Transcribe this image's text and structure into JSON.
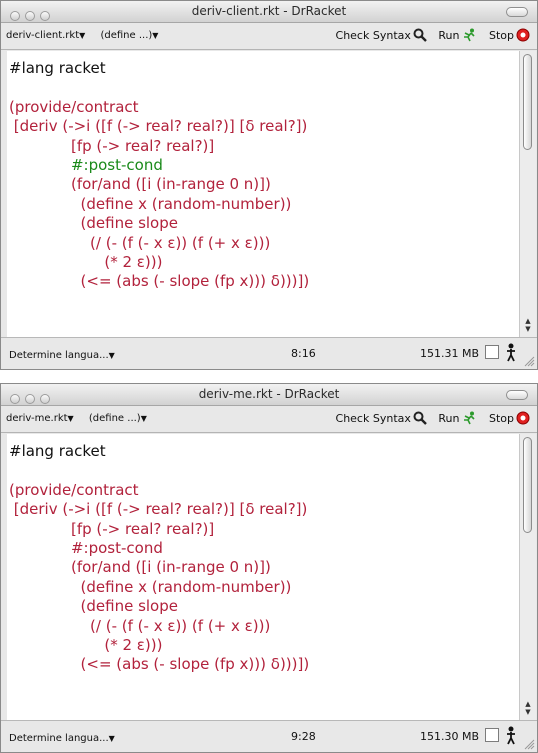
{
  "windows": [
    {
      "title": "deriv-client.rkt - DrRacket",
      "file_menu": "deriv-client.rkt",
      "define_menu": "(define ...)",
      "check_syntax": "Check Syntax",
      "run": "Run",
      "stop": "Stop",
      "code": [
        "#lang racket",
        "",
        "(provide/contract",
        " [deriv (->i ([f (-> real? real?)] [δ real?])",
        "             [fp (-> real? real?)]",
        "             #:post-cond",
        "             (for/and ([i (in-range 0 n)])",
        "               (define x (random-number))",
        "               (define slope",
        "                 (/ (- (f (- x ε)) (f (+ x ε)))",
        "                    (* 2 ε)))",
        "               (<= (abs (- slope (fp x))) δ)))])"
      ],
      "language": "Determine langua...",
      "position": "8:16",
      "memory": "151.31 MB"
    },
    {
      "title": "deriv-me.rkt - DrRacket",
      "file_menu": "deriv-me.rkt",
      "define_menu": "(define ...)",
      "check_syntax": "Check Syntax",
      "run": "Run",
      "stop": "Stop",
      "code": [
        "#lang racket",
        "",
        "(provide/contract",
        " [deriv (->i ([f (-> real? real?)] [δ real?])",
        "             [fp (-> real? real?)]",
        "             #:post-cond",
        "             (for/and ([i (in-range 0 n)])",
        "               (define x (random-number))",
        "               (define slope",
        "                 (/ (- (f (- x ε)) (f (+ x ε)))",
        "                    (* 2 ε)))",
        "               (<= (abs (- slope (fp x))) δ)))])"
      ],
      "language": "Determine langua...",
      "position": "9:28",
      "memory": "151.30 MB"
    }
  ],
  "colors": {
    "keyword": "#b2223c",
    "identifier": "#2a2a9c",
    "literal": "#1a8a1a",
    "stop_button": "#e02020",
    "run_icon": "#2c9a2c"
  },
  "icons": {
    "check_syntax": "magnifier-icon",
    "run": "running-figure-icon",
    "stop": "red-stop-circle-icon",
    "status": "walker-icon"
  }
}
